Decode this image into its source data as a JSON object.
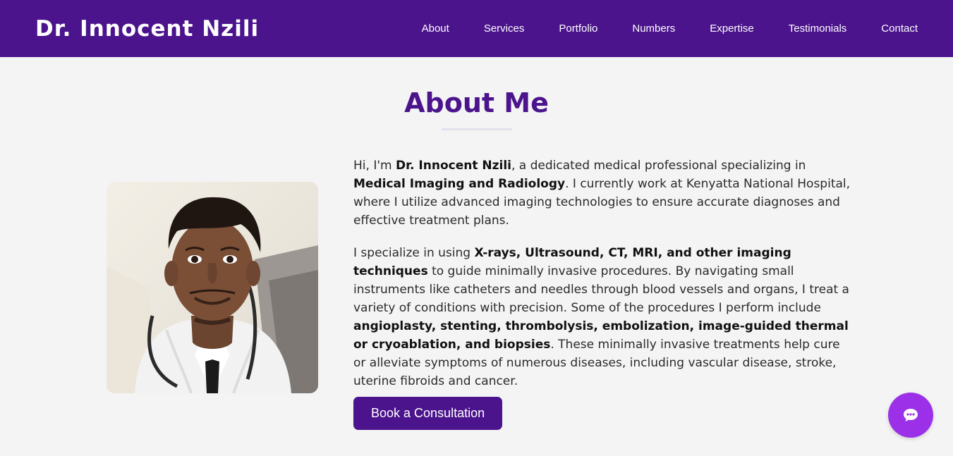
{
  "header": {
    "brand": "Dr. Innocent Nzili",
    "nav": [
      "About",
      "Services",
      "Portfolio",
      "Numbers",
      "Expertise",
      "Testimonials",
      "Contact"
    ]
  },
  "about": {
    "title": "About Me",
    "p1": [
      {
        "text": "Hi, I'm ",
        "bold": false
      },
      {
        "text": "Dr. Innocent Nzili",
        "bold": true
      },
      {
        "text": ", a dedicated medical professional specializing in ",
        "bold": false
      },
      {
        "text": "Medical Imaging and Radiology",
        "bold": true
      },
      {
        "text": ". I currently work at Kenyatta National Hospital, where I utilize advanced imaging technologies to ensure accurate diagnoses and effective treatment plans.",
        "bold": false
      }
    ],
    "p2": [
      {
        "text": "I specialize in using ",
        "bold": false
      },
      {
        "text": "X-rays, Ultrasound, CT, MRI, and other imaging techniques",
        "bold": true
      },
      {
        "text": " to guide minimally invasive procedures. By navigating small instruments like catheters and needles through blood vessels and organs, I treat a variety of conditions with precision. Some of the procedures I perform include ",
        "bold": false
      },
      {
        "text": "angioplasty, stenting, thrombolysis, embolization, image-guided thermal or cryoablation, and biopsies",
        "bold": true
      },
      {
        "text": ". These minimally invasive treatments help cure or alleviate symptoms of numerous diseases, including vascular disease, stroke, uterine fibroids and cancer.",
        "bold": false
      }
    ],
    "cta_label": "Book a Consultation"
  },
  "chat": {
    "icon": "chat-bubble-icon"
  },
  "colors": {
    "primary": "#4b148c",
    "accent": "#9b30e8",
    "background": "#f4f4f5"
  }
}
